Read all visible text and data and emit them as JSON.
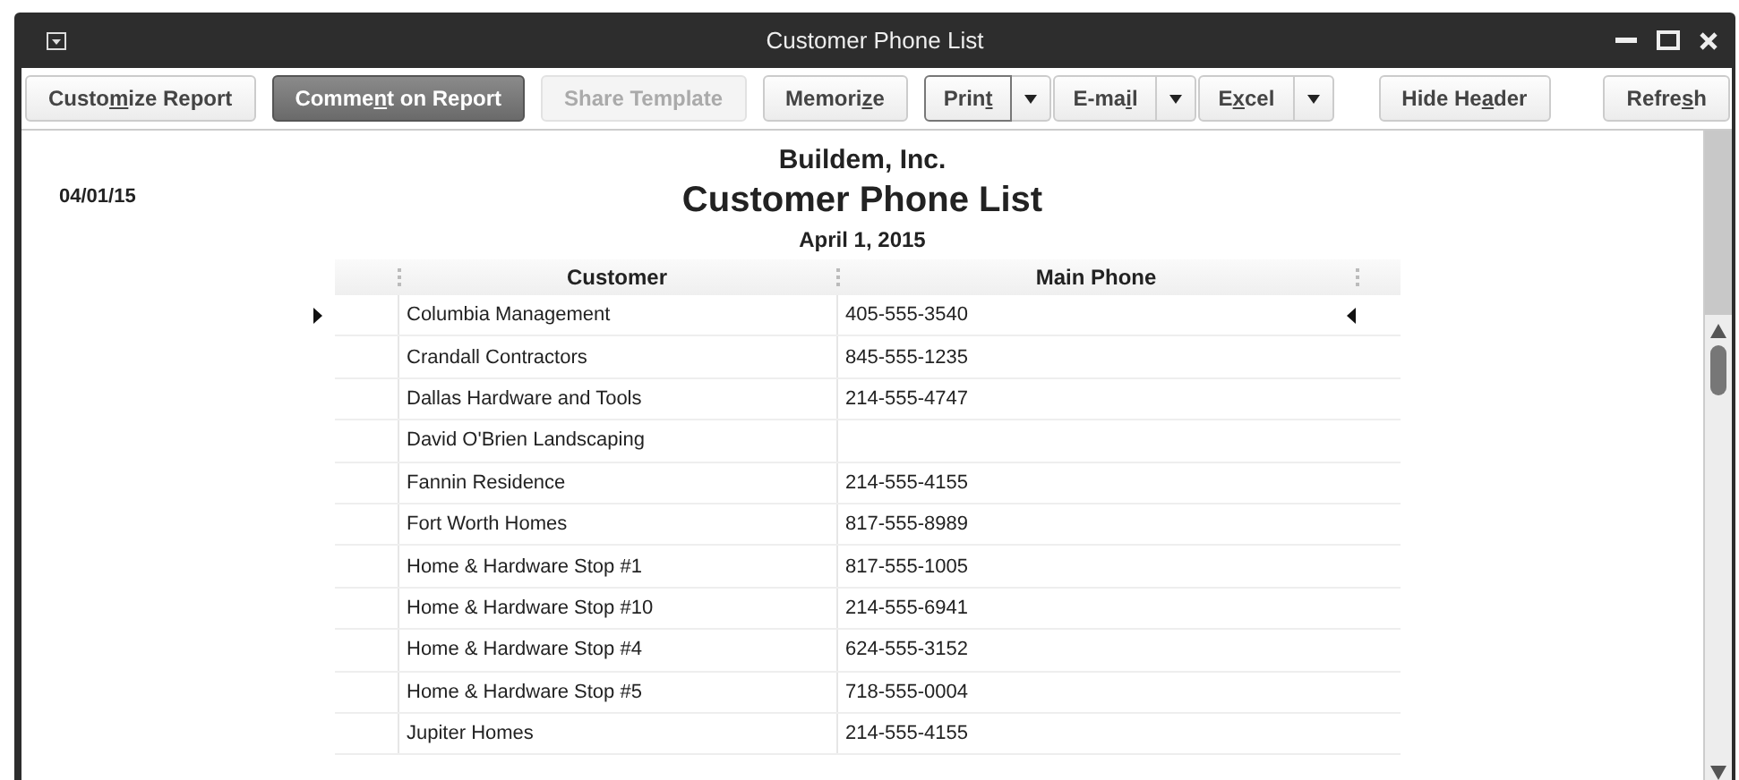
{
  "window": {
    "title": "Customer Phone List"
  },
  "toolbar": [
    {
      "before": "Custo",
      "key": "m",
      "after": "ize Report",
      "pressed": false,
      "disabled": false,
      "has_menu": false,
      "focused": false
    },
    {
      "before": "Comme",
      "key": "n",
      "after": "t on Report",
      "pressed": true,
      "disabled": false,
      "has_menu": false,
      "focused": false
    },
    {
      "before": "Share Template",
      "pressed": false,
      "disabled": true,
      "has_menu": false,
      "focused": false
    },
    {
      "before": "Memori",
      "key": "z",
      "after": "e",
      "pressed": false,
      "disabled": false,
      "has_menu": false,
      "focused": false
    },
    {
      "before": "Prin",
      "key": "t",
      "pressed": false,
      "disabled": false,
      "has_menu": true,
      "focused": true
    },
    {
      "before": "E-ma",
      "key": "i",
      "after": "l",
      "pressed": false,
      "disabled": false,
      "has_menu": true,
      "focused": false
    },
    {
      "before": "E",
      "key": "x",
      "after": "cel",
      "pressed": false,
      "disabled": false,
      "has_menu": true,
      "focused": false
    },
    {
      "before": "Hide He",
      "key": "a",
      "after": "der",
      "pressed": false,
      "disabled": false,
      "has_menu": false,
      "focused": false
    },
    {
      "before": "Refre",
      "key": "s",
      "after": "h",
      "pressed": false,
      "disabled": false,
      "has_menu": false,
      "focused": false
    }
  ],
  "report": {
    "date": "04/01/15",
    "company": "Buildem, Inc.",
    "title": "Customer Phone List",
    "subtitle": "April 1, 2015",
    "columns": [
      "Customer",
      "Main Phone"
    ],
    "rows": [
      {
        "customer": "Columbia Management",
        "phone": "405-555-3540",
        "selected": true
      },
      {
        "customer": "Crandall Contractors",
        "phone": "845-555-1235",
        "selected": false
      },
      {
        "customer": "Dallas Hardware and Tools",
        "phone": "214-555-4747",
        "selected": false
      },
      {
        "customer": "David O'Brien Landscaping",
        "selected": false
      },
      {
        "customer": "Fannin Residence",
        "phone": "214-555-4155",
        "selected": false
      },
      {
        "customer": "Fort Worth Homes",
        "phone": "817-555-8989",
        "selected": false
      },
      {
        "customer": "Home & Hardware Stop #1",
        "phone": "817-555-1005",
        "selected": false
      },
      {
        "customer": "Home & Hardware Stop #10",
        "phone": "214-555-6941",
        "selected": false
      },
      {
        "customer": "Home & Hardware Stop #4",
        "phone": "624-555-3152",
        "selected": false
      },
      {
        "customer": "Home & Hardware Stop #5",
        "phone": "718-555-0004",
        "selected": false
      },
      {
        "customer": "Jupiter Homes",
        "phone": "214-555-4155",
        "selected": false
      }
    ]
  }
}
